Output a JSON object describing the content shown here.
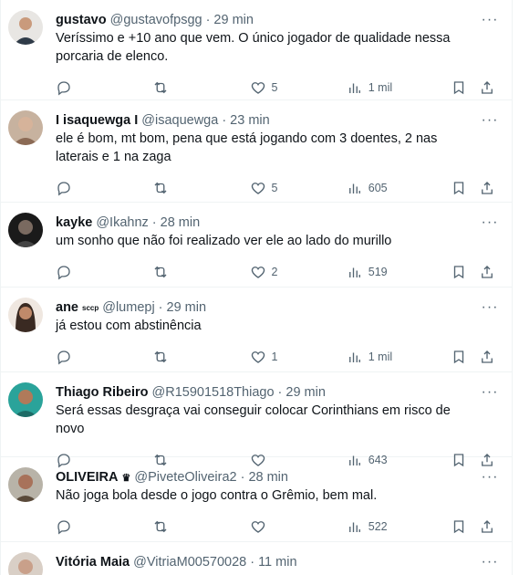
{
  "replies": [
    {
      "name": "gustavo",
      "badge": "",
      "handle": "@gustavofpsgg",
      "time": "29 min",
      "text": "Veríssimo e +10 ano que vem. O único jogador de qualidade nessa porcaria de elenco.",
      "likes": "5",
      "views": "1 mil",
      "avatar_color": "#2f3b48",
      "avatar_skin": "#c99a7c"
    },
    {
      "name": "I isaquewga I",
      "badge": "",
      "handle": "@isaquewga",
      "time": "23 min",
      "text": "ele é bom, mt bom, pena que está jogando com 3 doentes, 2 nas laterais e 1 na zaga",
      "likes": "5",
      "views": "605",
      "avatar_color": "#8b6a55",
      "avatar_skin": "#d6b39a"
    },
    {
      "name": "kayke",
      "badge": "",
      "handle": "@Ikahnz",
      "time": "28 min",
      "text": "um sonho que não foi realizado ver ele ao lado do murillo",
      "likes": "2",
      "views": "519",
      "avatar_color": "#1a1a1a",
      "avatar_skin": "#7a6a60"
    },
    {
      "name": "ane",
      "badge": "sccp",
      "handle": "@lumepj",
      "time": "29 min",
      "text": "já estou com abstinência",
      "likes": "1",
      "views": "1 mil",
      "avatar_color": "#3a2a22",
      "avatar_skin": "#c08a6a"
    },
    {
      "name": "Thiago Ribeiro",
      "badge": "",
      "handle": "@R15901518Thiago",
      "time": "29 min",
      "text": "Será essas desgraça vai conseguir colocar Corinthians em risco de novo",
      "likes": "",
      "views": "643",
      "avatar_color": "#2aa39a",
      "avatar_skin": "#b07a5a"
    },
    {
      "name": "OLIVEIRA",
      "badge": "♛",
      "handle": "@PiveteOliveira2",
      "time": "28 min",
      "text": "Não joga bola desde o jogo contra o Grêmio, bem mal.",
      "likes": "",
      "views": "522",
      "avatar_color": "#b8b3a8",
      "avatar_skin": "#a8725a"
    },
    {
      "name": "Vitória Maia",
      "badge": "",
      "handle": "@VitriaM00570028",
      "time": "11 min",
      "text": "",
      "likes": "",
      "views": "",
      "avatar_color": "#6b5a4a",
      "avatar_skin": "#c9a08a"
    }
  ]
}
